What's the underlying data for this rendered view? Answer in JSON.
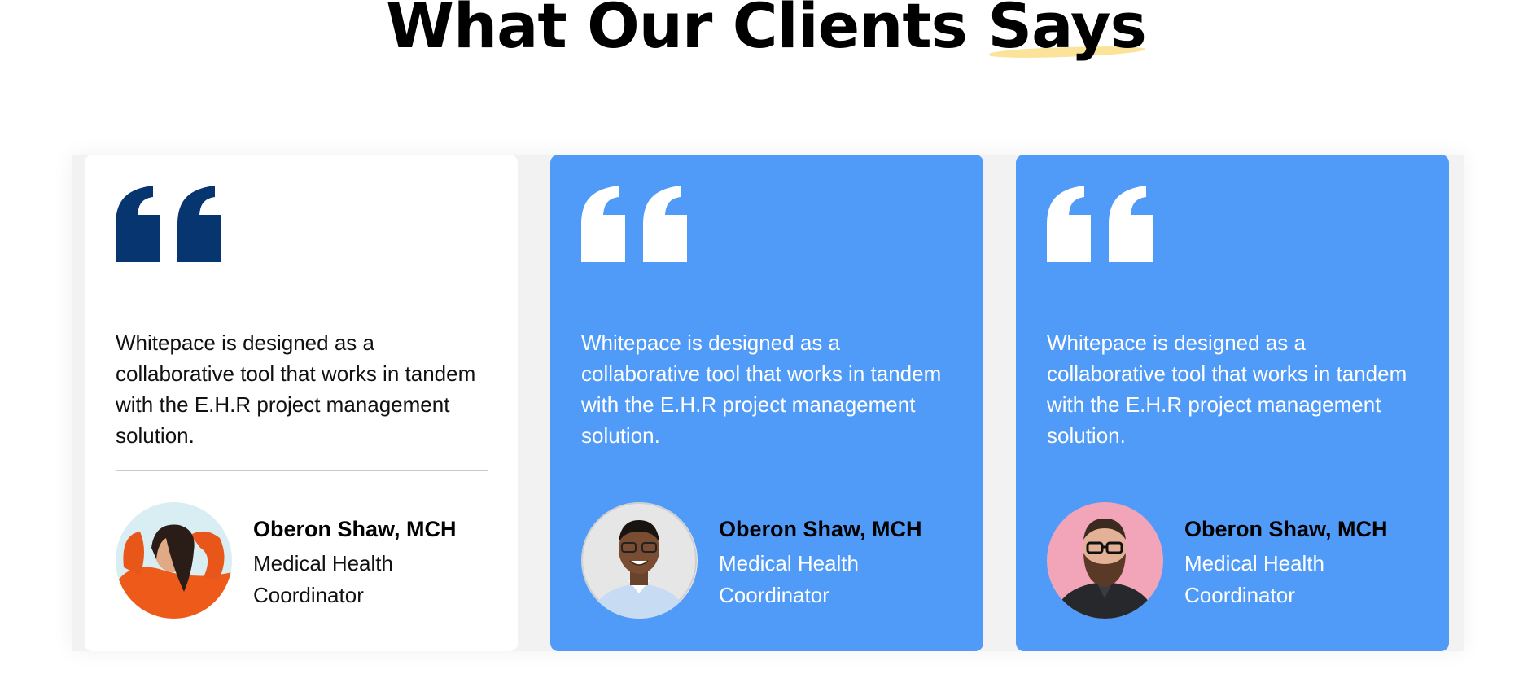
{
  "section": {
    "title_main": "What Our Clients",
    "title_highlight": "Says",
    "highlight_color": "#fbe39a"
  },
  "colors": {
    "card_blue": "#519bf8",
    "quote_dark": "#06356f",
    "quote_light": "#ffffff"
  },
  "testimonials": [
    {
      "quote": "Whitepace is designed as a collaborative tool that works in tandem with the E.H.R project management solution.",
      "name": "Oberon Shaw, MCH",
      "role": "Medical Health Coordinator",
      "theme": "white",
      "avatar_icon": "woman-orange-sweater-avatar"
    },
    {
      "quote": "Whitepace is designed as a collaborative tool that works in tandem with the E.H.R project management solution.",
      "name": "Oberon Shaw, MCH",
      "role": "Medical Health Coordinator",
      "theme": "blue",
      "avatar_icon": "man-glasses-smiling-avatar"
    },
    {
      "quote": "Whitepace is designed as a collaborative tool that works in tandem with the E.H.R project management solution.",
      "name": "Oberon Shaw, MCH",
      "role": "Medical Health Coordinator",
      "theme": "blue",
      "avatar_icon": "bearded-man-pink-background-avatar"
    }
  ]
}
